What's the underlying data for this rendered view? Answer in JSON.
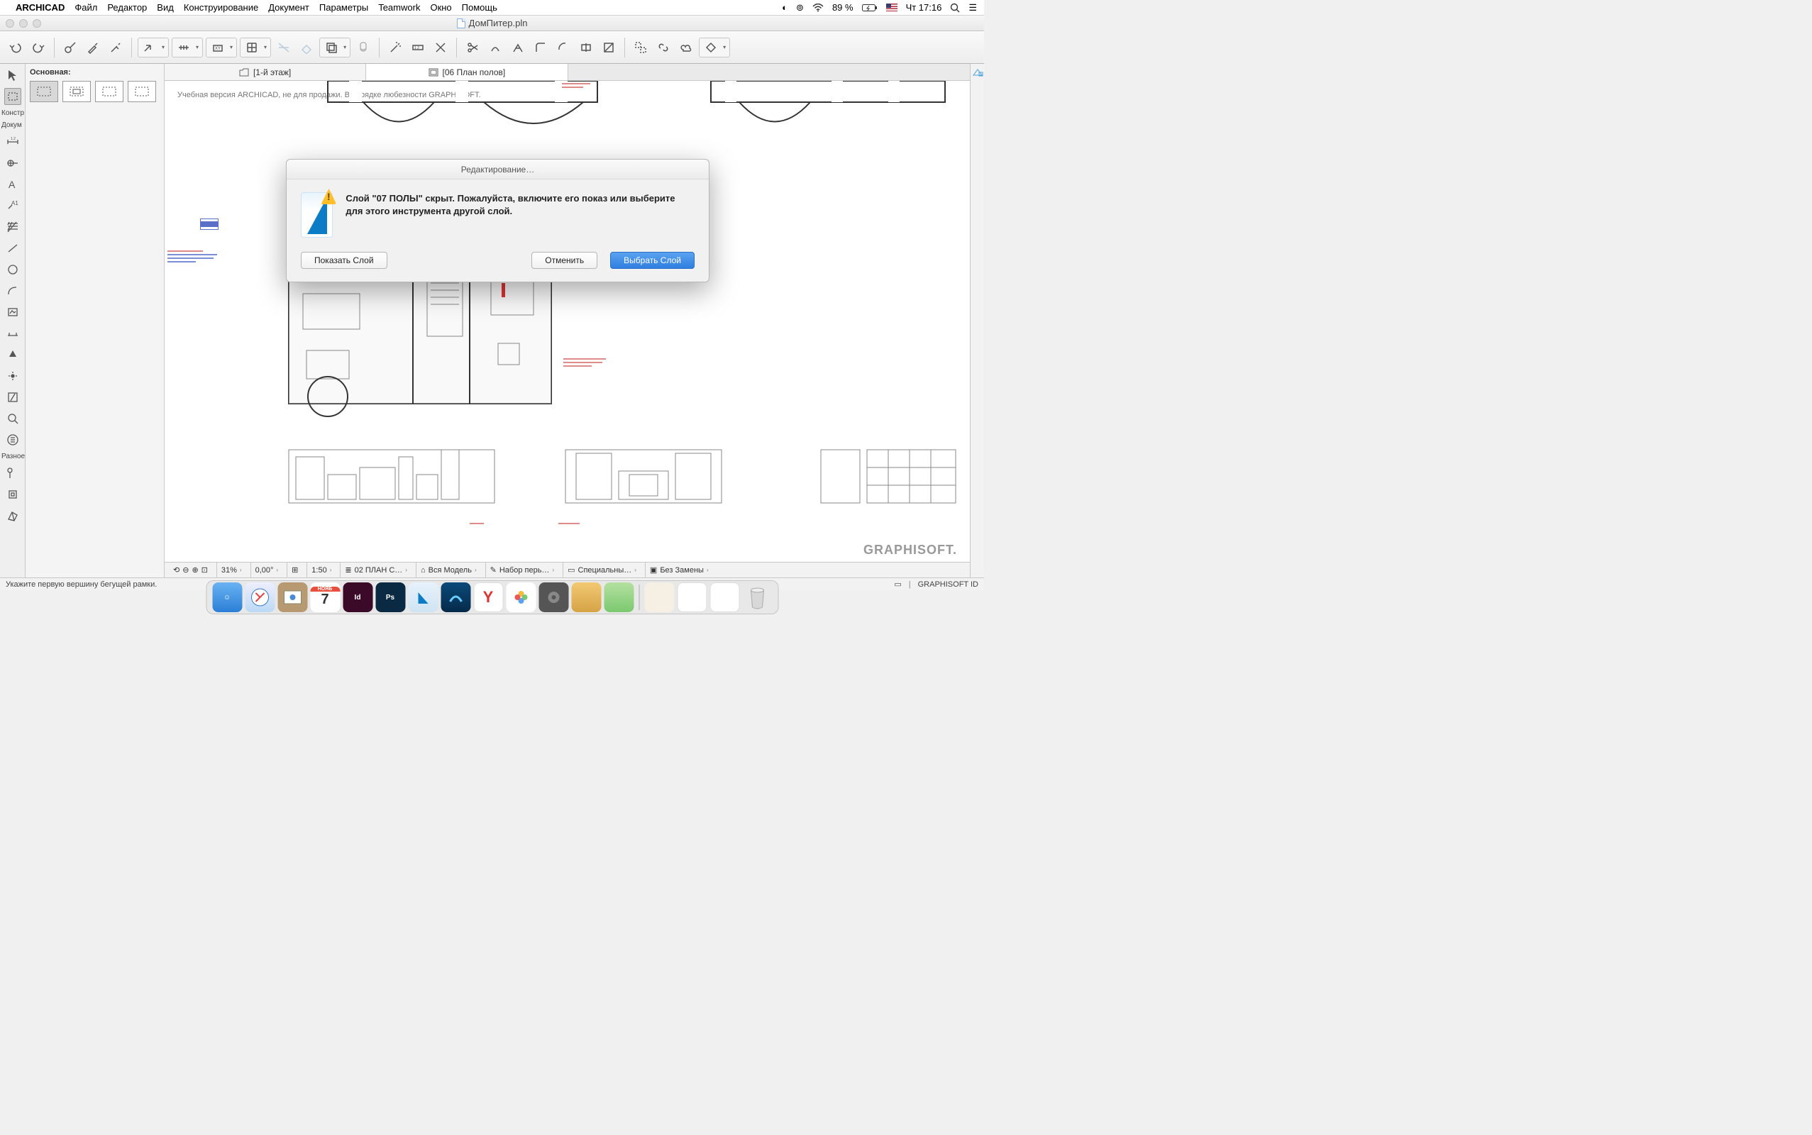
{
  "menubar": {
    "app": "ARCHICAD",
    "items": [
      "Файл",
      "Редактор",
      "Вид",
      "Конструирование",
      "Документ",
      "Параметры",
      "Teamwork",
      "Окно",
      "Помощь"
    ],
    "battery": "89 %",
    "clock": "Чт 17:16"
  },
  "titlebar": {
    "document": "ДомПитер.pln"
  },
  "infobar": {
    "header": "Основная:"
  },
  "left_labels": {
    "konstr": "Констр",
    "dokum": "Докум",
    "razno": "Разное"
  },
  "tabs": [
    {
      "icon": "folder-icon",
      "label": "[1-й этаж]"
    },
    {
      "icon": "sheet-icon",
      "label": "[06 План полов]"
    }
  ],
  "watermark": "Учебная версия ARCHICAD, не для продажи. В порядке любезности GRAPHISOFT.",
  "brand": "GRAPHISOFT.",
  "quickbar": {
    "zoom": "31%",
    "angle": "0,00°",
    "scale": "1:50",
    "layerset": "02 ПЛАН С…",
    "model": "Вся Модель",
    "penset": "Набор перь…",
    "drawset": "Специальны…",
    "override": "Без Замены"
  },
  "statusbar": {
    "hint": "Укажите первую вершину бегущей рамки.",
    "idlabel": "GRAPHISOFT ID"
  },
  "dialog": {
    "title": "Редактирование…",
    "message": "Слой \"07 ПОЛЫ\" скрыт. Пожалуйста, включите его показ или выберите для этого инструмента другой слой.",
    "btn_show": "Показать Слой",
    "btn_cancel": "Отменить",
    "btn_select": "Выбрать Слой"
  },
  "dock": {
    "calendar_month": "НОЯБ",
    "calendar_day": "7"
  }
}
